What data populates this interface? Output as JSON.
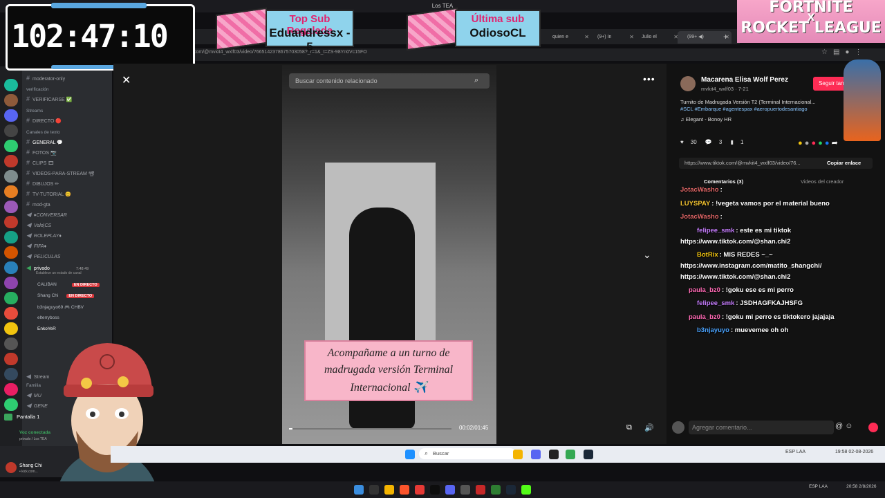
{
  "window": {
    "title": "Los TEA"
  },
  "timer": {
    "value": "102:47:10"
  },
  "banners": {
    "sub_gift_title": "Top Sub Regalada",
    "sub_gift_name": "Eduandressx - 5",
    "last_sub_title": "Última sub",
    "last_sub_name": "OdiosoCL",
    "promo_line1": "FORTNITE",
    "promo_line2": "X",
    "promo_line3": "ROCKET LEAGUE"
  },
  "browser": {
    "url": "com/@mvkit4_wxlf03/video/7665142378675703058?_r=1&_t=ZS-98Yn0Vc15FO",
    "tabs": [
      {
        "label": "quien e"
      },
      {
        "label": "(9+) In"
      },
      {
        "label": "Julio el"
      },
      {
        "label": "(99+ ◀)"
      }
    ]
  },
  "discord": {
    "server_name": "Los TEA",
    "categories": {
      "verificacion": "verificación",
      "streams": "Streams",
      "text_channels": "Canales de texto",
      "family": "Familia"
    },
    "channels": [
      "moderator-only",
      "VERIFICARSE ✅",
      "DIRECTO 🔴",
      "GENERAL 💬",
      "FOTOS 📷",
      "CLIPS 🎞",
      "VIDEOS-PARA-STREAM 📽",
      "DIBUJOS ✏",
      "TV-TUTORIAL 😊",
      "mod-gta",
      "♦CONVERSAR",
      "Valo|CS",
      "ROLEPLAY♦",
      "FIFA♦",
      "PELICULAS"
    ],
    "voice_channel": {
      "name": "privado",
      "time": "7:48:49",
      "status": "Establece un estado de canal"
    },
    "voice_users": [
      {
        "name": "CALIBAN",
        "live": "EN DIRECTO"
      },
      {
        "name": "Shang Chi",
        "live": "EN DIRECTO"
      },
      {
        "name": "b3njaguyo69 🎮 CHBV",
        "live": ""
      },
      {
        "name": "elterryboss",
        "live": ""
      },
      {
        "name": "EnkoYeR",
        "live": ""
      }
    ],
    "bottom_channels": [
      "Stream",
      "MU",
      "GENE"
    ],
    "screen_share": "Pantalla 1",
    "voice_connected": "Voz conectada",
    "voice_connected_sub": "privado / Los TEA",
    "user": {
      "name": "Shang Chi",
      "sub": "• kick.com..."
    }
  },
  "tiktok": {
    "search_placeholder": "Buscar contenido relacionado",
    "caption": [
      "Acompañame a un turno de",
      "madrugada versión Terminal",
      "Internacional ✈️"
    ],
    "timecode": "00:02/01:45",
    "progress": 0.02,
    "author": "Macarena Elisa Wolf Perez",
    "handle": "mvkit4_wxlf03 · 7-21",
    "follow_label": "Seguir también",
    "description": "Turnito de Madrugada Versión T2 (Terminal Internacional...",
    "tags": "#SCL #Embarque #agentespax #aeropuertodesantiago",
    "music": "♫  Elegant - Bonoy HR",
    "likes": "30",
    "comments": "3",
    "saves": "1",
    "link": "https://www.tiktok.com/@mvkit4_wxlf03/video/76...",
    "copy_label": "Copiar enlace",
    "tab_comments": "Comentarios (3)",
    "tab_creator": "Videos del creador",
    "comment_placeholder": "Agregar comentario..."
  },
  "chat": [
    {
      "user": "JotacWasho",
      "color": "#e06666",
      "msg": ":"
    },
    {
      "user": "LUYSPAY",
      "color": "#f4c430",
      "msg": ": !vegeta vamos por el material bueno"
    },
    {
      "user": "JotacWasho",
      "color": "#e06666",
      "msg": ": "
    },
    {
      "user": "felipee_smk",
      "color": "#c77dff",
      "msg": ": este es mi tiktok"
    },
    {
      "user": "",
      "color": "#ffffff",
      "msg": "https://www.tiktok.com/@shan.chi2"
    },
    {
      "user": "BotRix",
      "color": "#f1c40f",
      "msg": ": MIS REDES ~_~"
    },
    {
      "user": "",
      "color": "#ffffff",
      "msg": "https://www.instagram.com/matito_shangchi/"
    },
    {
      "user": "",
      "color": "#ffffff",
      "msg": "https://www.tiktok.com/@shan.chi2"
    },
    {
      "user": "paula_bz0",
      "color": "#ff69b4",
      "msg": ": !goku ese es mi perro"
    },
    {
      "user": "felipee_smk",
      "color": "#c77dff",
      "msg": ": JSDHAGFKAJHSFG"
    },
    {
      "user": "paula_bz0",
      "color": "#ff69b4",
      "msg": ": !goku mi perro es tiktokero jajajaja"
    },
    {
      "user": "b3njayuyo",
      "color": "#4aa3ff",
      "msg": ": muevemee oh oh"
    }
  ],
  "taskbar": {
    "search": "Buscar",
    "lang": "ESP LAA",
    "time_top": "19:58",
    "date_top": "02-08-2026",
    "time_bottom": "20:58",
    "date_bottom": "2/8/2026"
  }
}
